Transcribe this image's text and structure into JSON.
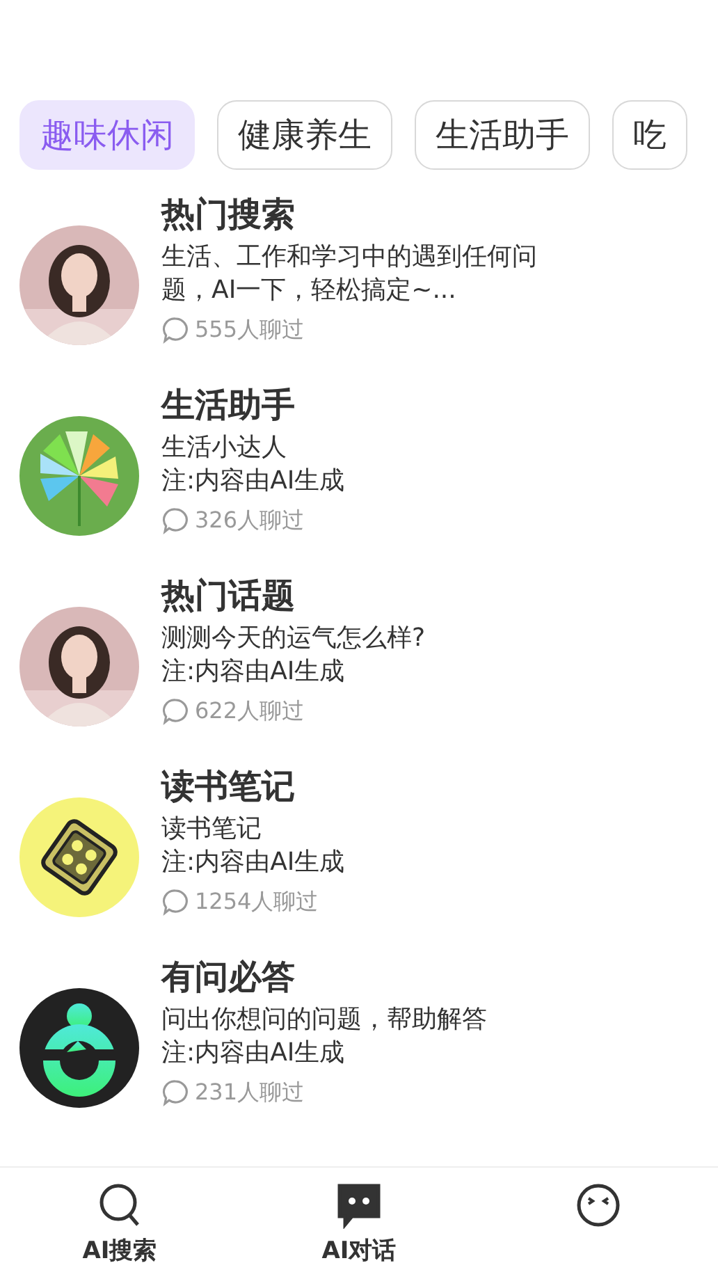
{
  "categories": [
    {
      "label": "趣味休闲",
      "selected": true
    },
    {
      "label": "健康养生",
      "selected": false
    },
    {
      "label": "生活助手",
      "selected": false
    },
    {
      "label": "吃",
      "selected": false
    }
  ],
  "bots": [
    {
      "title": "热门搜索",
      "kind": "picture",
      "lines": [
        "生活、工作和学习中的遇到任何问题，AI一下，轻松搞定~..."
      ],
      "count": "555人聊过"
    },
    {
      "title": "生活助手",
      "kind": "fan",
      "lines": [
        "生活小达人",
        "注:内容由AI生成"
      ],
      "count": "326人聊过"
    },
    {
      "title": "热门话题",
      "kind": "picture",
      "lines": [
        "测测今天的运气怎么样?",
        "注:内容由AI生成"
      ],
      "count": "622人聊过"
    },
    {
      "title": "读书笔记",
      "kind": "book",
      "lines": [
        "读书笔记",
        "注:内容由AI生成"
      ],
      "count": "1254人聊过"
    },
    {
      "title": "有问必答",
      "kind": "robot",
      "lines": [
        "问出你想问的问题，帮助解答",
        "注:内容由AI生成"
      ],
      "count": "231人聊过"
    }
  ],
  "bottom_nav": [
    {
      "label": "AI搜索",
      "kind": "search",
      "selected": false
    },
    {
      "label": "AI对话",
      "kind": "chat",
      "selected": true
    },
    {
      "kind": "face",
      "selected": false
    }
  ]
}
